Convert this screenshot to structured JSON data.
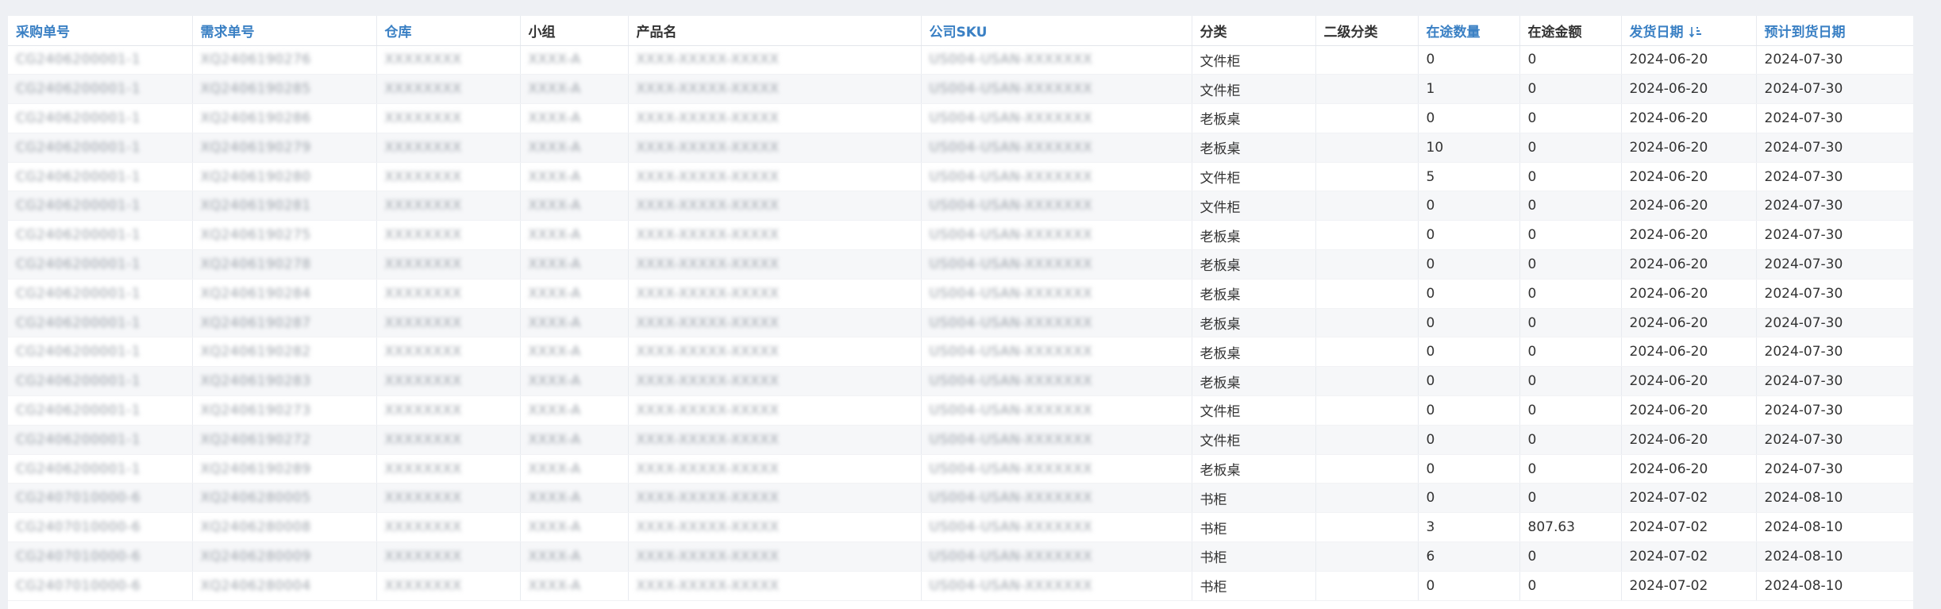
{
  "headers": {
    "po_no": "采购单号",
    "req_no": "需求单号",
    "warehouse": "仓库",
    "group": "小组",
    "product": "产品名",
    "sku": "公司SKU",
    "category": "分类",
    "subcategory": "二级分类",
    "transit_qty": "在途数量",
    "transit_amount": "在途金额",
    "ship_date": "发货日期",
    "eta_date": "预计到货日期"
  },
  "icons": {
    "ship_date_sort": "sort-descending-icon"
  },
  "colors": {
    "link_header": "#3a80c4"
  },
  "rows": [
    {
      "po": "CG2406200001-1",
      "req": "XQ2406190276",
      "wh": "XXXXXXXX",
      "grp": "XXXX-A",
      "prod": "XXXX-XXXXX-XXXXX",
      "sku": "US004-USAN-XXXXXXX",
      "cat": "文件柜",
      "sub": "",
      "qty": "0",
      "amt": "0",
      "ship": "2024-06-20",
      "eta": "2024-07-30"
    },
    {
      "po": "CG2406200001-1",
      "req": "XQ2406190285",
      "wh": "XXXXXXXX",
      "grp": "XXXX-A",
      "prod": "XXXX-XXXXX-XXXXX",
      "sku": "US004-USAN-XXXXXXX",
      "cat": "文件柜",
      "sub": "",
      "qty": "1",
      "amt": "0",
      "ship": "2024-06-20",
      "eta": "2024-07-30"
    },
    {
      "po": "CG2406200001-1",
      "req": "XQ2406190286",
      "wh": "XXXXXXXX",
      "grp": "XXXX-A",
      "prod": "XXXX-XXXXX-XXXXX",
      "sku": "US004-USAN-XXXXXXX",
      "cat": "老板桌",
      "sub": "",
      "qty": "0",
      "amt": "0",
      "ship": "2024-06-20",
      "eta": "2024-07-30"
    },
    {
      "po": "CG2406200001-1",
      "req": "XQ2406190279",
      "wh": "XXXXXXXX",
      "grp": "XXXX-A",
      "prod": "XXXX-XXXXX-XXXXX",
      "sku": "US004-USAN-XXXXXXX",
      "cat": "老板桌",
      "sub": "",
      "qty": "10",
      "amt": "0",
      "ship": "2024-06-20",
      "eta": "2024-07-30"
    },
    {
      "po": "CG2406200001-1",
      "req": "XQ2406190280",
      "wh": "XXXXXXXX",
      "grp": "XXXX-A",
      "prod": "XXXX-XXXXX-XXXXX",
      "sku": "US004-USAN-XXXXXXX",
      "cat": "文件柜",
      "sub": "",
      "qty": "5",
      "amt": "0",
      "ship": "2024-06-20",
      "eta": "2024-07-30"
    },
    {
      "po": "CG2406200001-1",
      "req": "XQ2406190281",
      "wh": "XXXXXXXX",
      "grp": "XXXX-A",
      "prod": "XXXX-XXXXX-XXXXX",
      "sku": "US004-USAN-XXXXXXX",
      "cat": "文件柜",
      "sub": "",
      "qty": "0",
      "amt": "0",
      "ship": "2024-06-20",
      "eta": "2024-07-30"
    },
    {
      "po": "CG2406200001-1",
      "req": "XQ2406190275",
      "wh": "XXXXXXXX",
      "grp": "XXXX-A",
      "prod": "XXXX-XXXXX-XXXXX",
      "sku": "US004-USAN-XXXXXXX",
      "cat": "老板桌",
      "sub": "",
      "qty": "0",
      "amt": "0",
      "ship": "2024-06-20",
      "eta": "2024-07-30"
    },
    {
      "po": "CG2406200001-1",
      "req": "XQ2406190278",
      "wh": "XXXXXXXX",
      "grp": "XXXX-A",
      "prod": "XXXX-XXXXX-XXXXX",
      "sku": "US004-USAN-XXXXXXX",
      "cat": "老板桌",
      "sub": "",
      "qty": "0",
      "amt": "0",
      "ship": "2024-06-20",
      "eta": "2024-07-30"
    },
    {
      "po": "CG2406200001-1",
      "req": "XQ2406190284",
      "wh": "XXXXXXXX",
      "grp": "XXXX-A",
      "prod": "XXXX-XXXXX-XXXXX",
      "sku": "US004-USAN-XXXXXXX",
      "cat": "老板桌",
      "sub": "",
      "qty": "0",
      "amt": "0",
      "ship": "2024-06-20",
      "eta": "2024-07-30"
    },
    {
      "po": "CG2406200001-1",
      "req": "XQ2406190287",
      "wh": "XXXXXXXX",
      "grp": "XXXX-A",
      "prod": "XXXX-XXXXX-XXXXX",
      "sku": "US004-USAN-XXXXXXX",
      "cat": "老板桌",
      "sub": "",
      "qty": "0",
      "amt": "0",
      "ship": "2024-06-20",
      "eta": "2024-07-30"
    },
    {
      "po": "CG2406200001-1",
      "req": "XQ2406190282",
      "wh": "XXXXXXXX",
      "grp": "XXXX-A",
      "prod": "XXXX-XXXXX-XXXXX",
      "sku": "US004-USAN-XXXXXXX",
      "cat": "老板桌",
      "sub": "",
      "qty": "0",
      "amt": "0",
      "ship": "2024-06-20",
      "eta": "2024-07-30"
    },
    {
      "po": "CG2406200001-1",
      "req": "XQ2406190283",
      "wh": "XXXXXXXX",
      "grp": "XXXX-A",
      "prod": "XXXX-XXXXX-XXXXX",
      "sku": "US004-USAN-XXXXXXX",
      "cat": "老板桌",
      "sub": "",
      "qty": "0",
      "amt": "0",
      "ship": "2024-06-20",
      "eta": "2024-07-30"
    },
    {
      "po": "CG2406200001-1",
      "req": "XQ2406190273",
      "wh": "XXXXXXXX",
      "grp": "XXXX-A",
      "prod": "XXXX-XXXXX-XXXXX",
      "sku": "US004-USAN-XXXXXXX",
      "cat": "文件柜",
      "sub": "",
      "qty": "0",
      "amt": "0",
      "ship": "2024-06-20",
      "eta": "2024-07-30"
    },
    {
      "po": "CG2406200001-1",
      "req": "XQ2406190272",
      "wh": "XXXXXXXX",
      "grp": "XXXX-A",
      "prod": "XXXX-XXXXX-XXXXX",
      "sku": "US004-USAN-XXXXXXX",
      "cat": "文件柜",
      "sub": "",
      "qty": "0",
      "amt": "0",
      "ship": "2024-06-20",
      "eta": "2024-07-30"
    },
    {
      "po": "CG2406200001-1",
      "req": "XQ2406190289",
      "wh": "XXXXXXXX",
      "grp": "XXXX-A",
      "prod": "XXXX-XXXXX-XXXXX",
      "sku": "US004-USAN-XXXXXXX",
      "cat": "老板桌",
      "sub": "",
      "qty": "0",
      "amt": "0",
      "ship": "2024-06-20",
      "eta": "2024-07-30"
    },
    {
      "po": "CG2407010000-6",
      "req": "XQ2406280005",
      "wh": "XXXXXXXX",
      "grp": "XXXX-A",
      "prod": "XXXX-XXXXX-XXXXX",
      "sku": "US004-USAN-XXXXXXX",
      "cat": "书柜",
      "sub": "",
      "qty": "0",
      "amt": "0",
      "ship": "2024-07-02",
      "eta": "2024-08-10"
    },
    {
      "po": "CG2407010000-6",
      "req": "XQ2406280008",
      "wh": "XXXXXXXX",
      "grp": "XXXX-A",
      "prod": "XXXX-XXXXX-XXXXX",
      "sku": "US004-USAN-XXXXXXX",
      "cat": "书柜",
      "sub": "",
      "qty": "3",
      "amt": "807.63",
      "ship": "2024-07-02",
      "eta": "2024-08-10"
    },
    {
      "po": "CG2407010000-6",
      "req": "XQ2406280009",
      "wh": "XXXXXXXX",
      "grp": "XXXX-A",
      "prod": "XXXX-XXXXX-XXXXX",
      "sku": "US004-USAN-XXXXXXX",
      "cat": "书柜",
      "sub": "",
      "qty": "6",
      "amt": "0",
      "ship": "2024-07-02",
      "eta": "2024-08-10"
    },
    {
      "po": "CG2407010000-6",
      "req": "XQ2406280004",
      "wh": "XXXXXXXX",
      "grp": "XXXX-A",
      "prod": "XXXX-XXXXX-XXXXX",
      "sku": "US004-USAN-XXXXXXX",
      "cat": "书柜",
      "sub": "",
      "qty": "0",
      "amt": "0",
      "ship": "2024-07-02",
      "eta": "2024-08-10"
    }
  ]
}
